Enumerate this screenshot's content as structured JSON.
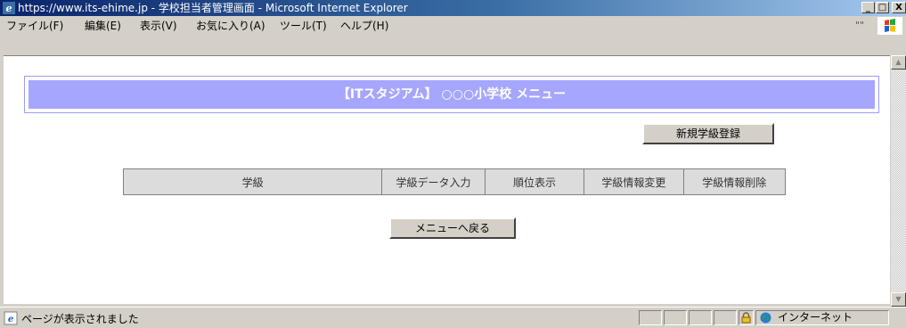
{
  "window": {
    "title": "https://www.its-ehime.jp - 学校担当者管理画面 - Microsoft Internet Explorer",
    "controls": {
      "minimize": "_",
      "maximize": "□",
      "close": "X"
    }
  },
  "menubar": {
    "items": [
      "ファイル(F)",
      "編集(E)",
      "表示(V)",
      "お気に入り(A)",
      "ツール(T)",
      "ヘルプ(H)"
    ],
    "overflow": "\"\""
  },
  "page": {
    "banner": "【ITスタジアム】 ○○○小学校 メニュー",
    "new_class_button": "新規学級登録",
    "table_headers": [
      "学級",
      "学級データ入力",
      "順位表示",
      "学級情報変更",
      "学級情報削除"
    ],
    "back_button": "メニューへ戻る"
  },
  "statusbar": {
    "text": "ページが表示されました",
    "zone": "インターネット"
  },
  "colors": {
    "banner_bg": "#a6a6ff",
    "titlebar_start": "#0a246a",
    "titlebar_end": "#a6caf0"
  },
  "icons": [
    "ie-icon",
    "windows-logo-icon",
    "scroll-up-icon",
    "scroll-down-icon",
    "page-done-icon",
    "lock-icon",
    "internet-globe-icon"
  ]
}
